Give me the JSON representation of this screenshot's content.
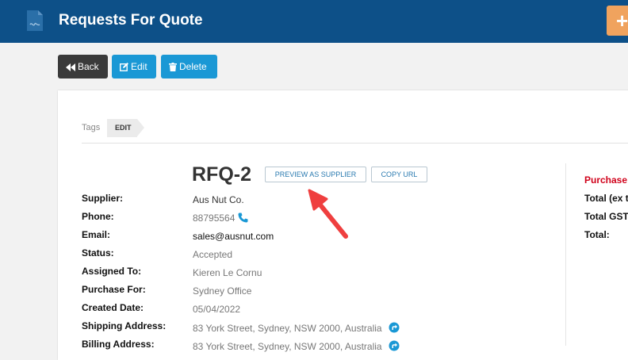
{
  "header": {
    "title": "Requests For Quote",
    "add_label": "+"
  },
  "toolbar": {
    "back_label": "Back",
    "edit_label": "Edit",
    "delete_label": "Delete"
  },
  "tags": {
    "label": "Tags",
    "edit_tag": "EDIT"
  },
  "rfq": {
    "title": "RFQ-2",
    "preview_label": "PREVIEW AS SUPPLIER",
    "copy_url_label": "COPY URL"
  },
  "details": [
    {
      "label": "Supplier:",
      "value": "Aus Nut Co."
    },
    {
      "label": "Phone:",
      "value": "88795564"
    },
    {
      "label": "Email:",
      "value": "sales@ausnut.com"
    },
    {
      "label": "Status:",
      "value": "Accepted"
    },
    {
      "label": "Assigned To:",
      "value": "Kieren Le Cornu"
    },
    {
      "label": "Purchase For:",
      "value": "Sydney Office"
    },
    {
      "label": "Created Date:",
      "value": "05/04/2022"
    },
    {
      "label": "Shipping Address:",
      "value": "83 York Street, Sydney, NSW 2000, Australia"
    },
    {
      "label": "Billing Address:",
      "value": "83 York Street, Sydney, NSW 2000, Australia"
    }
  ],
  "summary": {
    "purchase_label": "Purchase",
    "total_ex_label": "Total (ex t",
    "total_gst_label": "Total GST",
    "total_label": "Total:"
  },
  "colors": {
    "header_bg": "#0d5088",
    "accent": "#1a98d5",
    "add_button": "#f0a35e",
    "annotation_arrow": "#ef3f3f"
  }
}
